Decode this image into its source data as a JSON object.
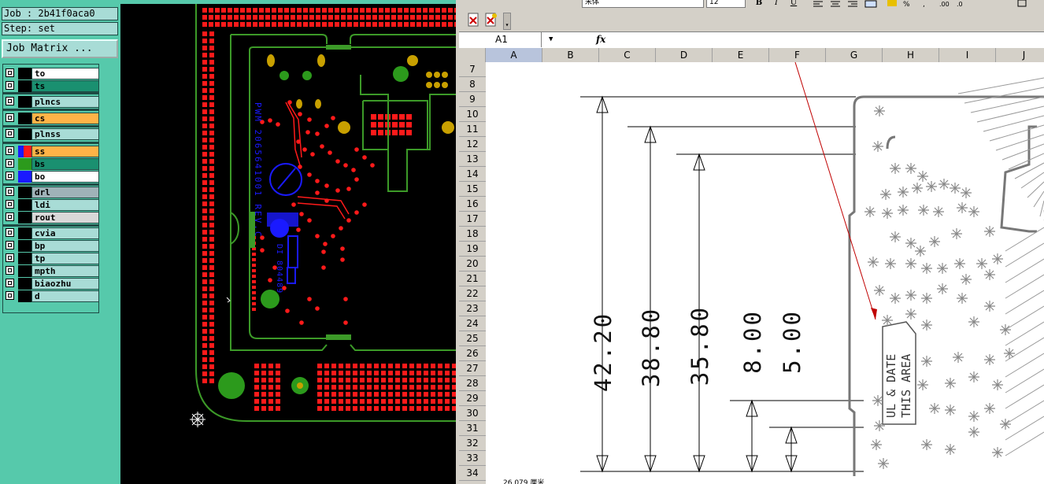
{
  "cam": {
    "job_label": "Job : 2b41f0aca0",
    "step_label": "Step: set",
    "matrix_button": "Job Matrix ...",
    "layers": [
      {
        "name": "to",
        "color": "#ffffff"
      },
      {
        "name": "ts",
        "color": "#1a9070"
      },
      {
        "name": "plncs",
        "color": "#a8dcd6"
      },
      {
        "name": "cs",
        "color": "#ffb347"
      },
      {
        "name": "plnss",
        "color": "#a8dcd6"
      },
      {
        "name": "ss",
        "color": "#ffb347"
      },
      {
        "name": "bs",
        "color": "#1a9070"
      },
      {
        "name": "bo",
        "color": "#ffffff"
      },
      {
        "name": "drl",
        "color": "#9fb2b8"
      },
      {
        "name": "ldi",
        "color": "#a8dcd6"
      },
      {
        "name": "rout",
        "color": "#d8d8d8"
      },
      {
        "name": "cvia",
        "color": "#a8dcd6"
      },
      {
        "name": "bp",
        "color": "#a8dcd6"
      },
      {
        "name": "tp",
        "color": "#a8dcd6"
      },
      {
        "name": "mpth",
        "color": "#a8dcd6"
      },
      {
        "name": "biaozhu",
        "color": "#a8dcd6"
      },
      {
        "name": "d",
        "color": "#a8dcd6"
      }
    ],
    "colors": {
      "panel": "#56c9ab",
      "pad": "#ff1a1a",
      "outline": "#3c9a28",
      "blue": "#1a1aff",
      "yellow": "#c8a000"
    },
    "silk_text": [
      "PWM 2065641001 REV.C",
      "DI 804489"
    ]
  },
  "sheet": {
    "font_name": "宋体",
    "font_size": "12",
    "name_box": "A1",
    "fx": "fx",
    "columns": [
      "A",
      "B",
      "C",
      "D",
      "E",
      "F",
      "G",
      "H",
      "I",
      "J"
    ],
    "rows": [
      "7",
      "8",
      "9",
      "10",
      "11",
      "12",
      "13",
      "14",
      "15",
      "16",
      "17",
      "18",
      "19",
      "20",
      "21",
      "22",
      "23",
      "24",
      "25",
      "26",
      "27",
      "28",
      "29",
      "30",
      "31",
      "32",
      "33",
      "34"
    ],
    "dimensions": [
      "42.20",
      "38.80",
      "35.80",
      "8.00",
      "5.00"
    ],
    "ul_text_1": "UL & DATE",
    "ul_text_2": "THIS AREA",
    "status": "26.079 厘米"
  }
}
